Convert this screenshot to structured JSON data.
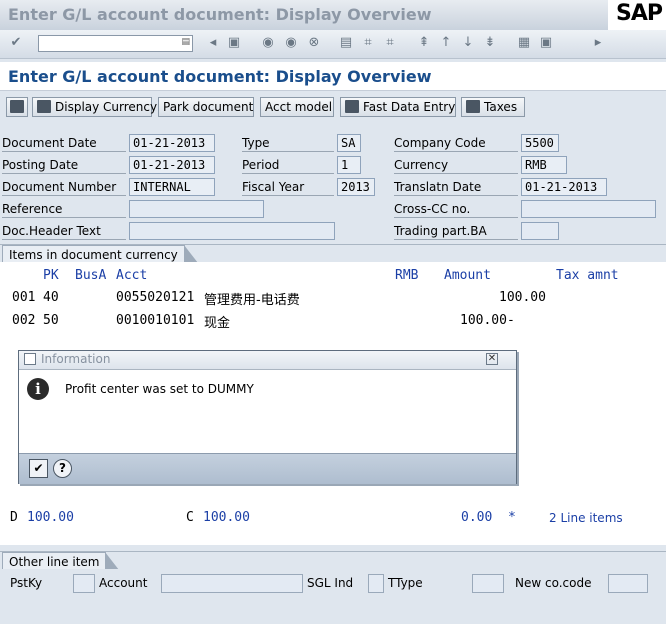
{
  "window": {
    "title": "Enter G/L account document: Display Overview",
    "logo": "SAP"
  },
  "screen_title": "Enter G/L account document: Display Overview",
  "toolbar": {
    "buttons": [
      "Display Currency",
      "Park document",
      "Acct model",
      "Fast Data Entry",
      "Taxes"
    ]
  },
  "header": {
    "document_date": {
      "label": "Document Date",
      "value": "01-21-2013"
    },
    "posting_date": {
      "label": "Posting Date",
      "value": "01-21-2013"
    },
    "document_number": {
      "label": "Document Number",
      "value": "INTERNAL"
    },
    "reference": {
      "label": "Reference",
      "value": ""
    },
    "doc_header_text": {
      "label": "Doc.Header Text",
      "value": ""
    },
    "type": {
      "label": "Type",
      "value": "SA"
    },
    "period": {
      "label": "Period",
      "value": "1"
    },
    "fiscal_year": {
      "label": "Fiscal Year",
      "value": "2013"
    },
    "company_code": {
      "label": "Company Code",
      "value": "5500"
    },
    "currency": {
      "label": "Currency",
      "value": "RMB"
    },
    "translatn_date": {
      "label": "Translatn Date",
      "value": "01-21-2013"
    },
    "cross_cc": {
      "label": "Cross-CC no.",
      "value": ""
    },
    "trading_part": {
      "label": "Trading part.BA",
      "value": ""
    }
  },
  "items": {
    "tab_label": "Items in document currency",
    "columns": {
      "pk": "PK",
      "busa": "BusA",
      "acct": "Acct",
      "rmb": "RMB",
      "amount": "Amount",
      "tax": "Tax amnt"
    },
    "rows": [
      {
        "no": "001",
        "pk": "40",
        "acct": "0055020121",
        "text": "管理费用-电话费",
        "amount": "100.00"
      },
      {
        "no": "002",
        "pk": "50",
        "acct": "0010010101",
        "text": "现金",
        "amount": "100.00-"
      }
    ]
  },
  "dialog": {
    "title": "Information",
    "message": "Profit center was set to DUMMY"
  },
  "totals": {
    "debit_label": "D",
    "debit": "100.00",
    "credit_label": "C",
    "credit": "100.00",
    "balance": "0.00",
    "marker": "*",
    "line_items": "2 Line items"
  },
  "other_line_item": {
    "tab_label": "Other line item",
    "pstky": "PstKy",
    "account": "Account",
    "sgl_ind": "SGL Ind",
    "ttype": "TType",
    "new_co_code": "New co.code"
  }
}
